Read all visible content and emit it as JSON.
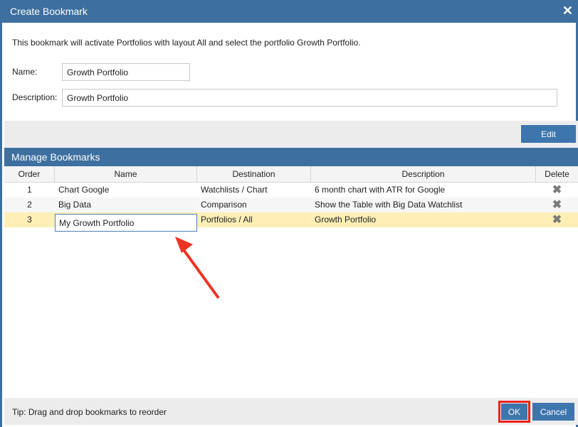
{
  "dialog": {
    "title": "Create Bookmark",
    "close_glyph": "✕",
    "info_text": "This bookmark will activate Portfolios with layout All and select the portfolio Growth Portfolio.",
    "name_label": "Name:",
    "name_value": "Growth Portfolio",
    "description_label": "Description:",
    "description_value": "Growth Portfolio",
    "edit_button": "Edit"
  },
  "manage": {
    "title": "Manage Bookmarks",
    "columns": [
      "Order",
      "Name",
      "Destination",
      "Description",
      "Delete"
    ],
    "rows": [
      {
        "order": "1",
        "name": "Chart Google",
        "destination": "Watchlists / Chart",
        "description": "6 month chart with ATR for Google"
      },
      {
        "order": "2",
        "name": "Big Data",
        "destination": "Comparison",
        "description": "Show the Table with Big Data Watchlist"
      },
      {
        "order": "3",
        "name": "My Growth Portfolio",
        "destination": "Portfolios / All",
        "description": "Growth Portfolio"
      }
    ],
    "delete_glyph": "✖",
    "editing_value": "My Growth Portfolio"
  },
  "footer": {
    "tip": "Tip: Drag and drop bookmarks to reorder",
    "ok": "OK",
    "cancel": "Cancel"
  },
  "colors": {
    "header_blue": "#3d6f9f",
    "button_blue": "#3d75ad",
    "selected_row": "#fdefb6",
    "annotation_red": "#ee3322"
  }
}
